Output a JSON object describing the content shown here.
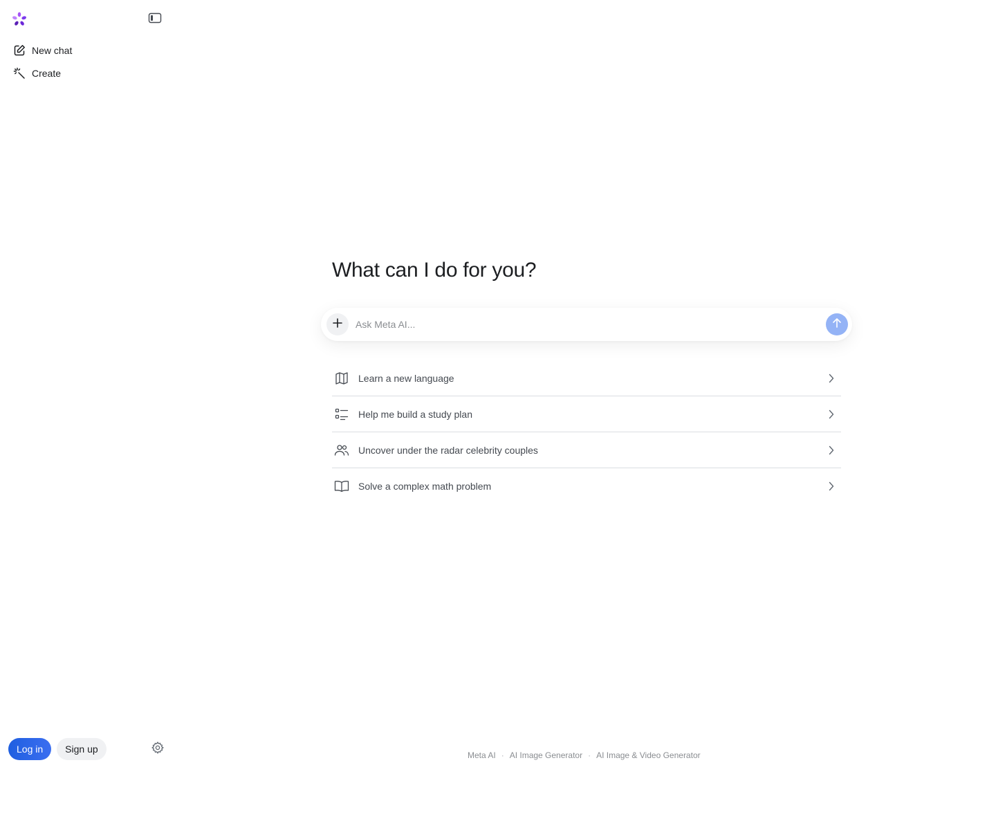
{
  "sidebar": {
    "nav": [
      {
        "label": "New chat",
        "icon": "edit-icon"
      },
      {
        "label": "Create",
        "icon": "magic-wand-icon"
      }
    ],
    "login_label": "Log in",
    "signup_label": "Sign up"
  },
  "main": {
    "heading": "What can I do for you?",
    "composer": {
      "placeholder": "Ask Meta AI..."
    },
    "suggestions": [
      {
        "label": "Learn a new language",
        "icon": "map-icon"
      },
      {
        "label": "Help me build a study plan",
        "icon": "checklist-icon"
      },
      {
        "label": "Uncover under the radar celebrity couples",
        "icon": "people-icon"
      },
      {
        "label": "Solve a complex math problem",
        "icon": "book-icon"
      }
    ]
  },
  "footer": {
    "links": [
      "Meta AI",
      "AI Image Generator",
      "AI Image & Video Generator"
    ],
    "separator": "·"
  },
  "colors": {
    "accent": "#1f5fe0",
    "send_disabled": "#94b3f6",
    "divider": "#dadde1"
  }
}
